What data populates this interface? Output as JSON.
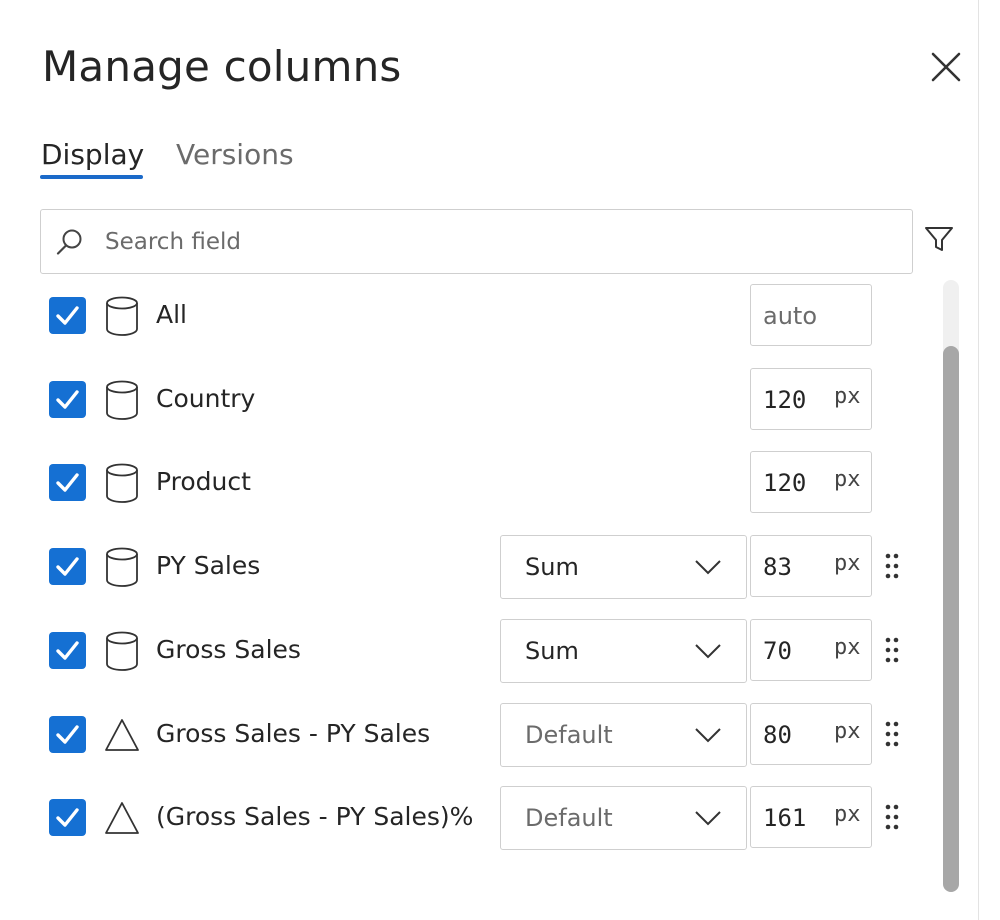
{
  "dialog": {
    "title": "Manage columns",
    "tabs": [
      {
        "label": "Display",
        "active": true
      },
      {
        "label": "Versions",
        "active": false
      }
    ],
    "search": {
      "placeholder": "Search field",
      "value": ""
    }
  },
  "colors": {
    "accent": "#1b6ac9",
    "checkbox": "#1570d3",
    "scrollbar_thumb": "#a7a7a7"
  },
  "rows": [
    {
      "label": "All",
      "icon": "database-icon",
      "checked": true,
      "aggregation": null,
      "width": "",
      "width_placeholder": "auto",
      "unit": "",
      "draggable": false
    },
    {
      "label": "Country",
      "icon": "database-icon",
      "checked": true,
      "aggregation": null,
      "width": "120",
      "unit": "px",
      "draggable": false
    },
    {
      "label": "Product",
      "icon": "database-icon",
      "checked": true,
      "aggregation": null,
      "width": "120",
      "unit": "px",
      "draggable": false
    },
    {
      "label": "PY Sales",
      "icon": "database-icon",
      "checked": true,
      "aggregation": "Sum",
      "width": "83",
      "unit": "px",
      "draggable": true
    },
    {
      "label": "Gross Sales",
      "icon": "database-icon",
      "checked": true,
      "aggregation": "Sum",
      "width": "70",
      "unit": "px",
      "draggable": true
    },
    {
      "label": "Gross Sales - PY Sales",
      "icon": "triangle-icon",
      "checked": true,
      "aggregation": "Default",
      "width": "80",
      "unit": "px",
      "draggable": true
    },
    {
      "label": "(Gross Sales - PY Sales)%",
      "icon": "triangle-icon",
      "checked": true,
      "aggregation": "Default",
      "width": "161",
      "unit": "px",
      "draggable": true
    }
  ]
}
